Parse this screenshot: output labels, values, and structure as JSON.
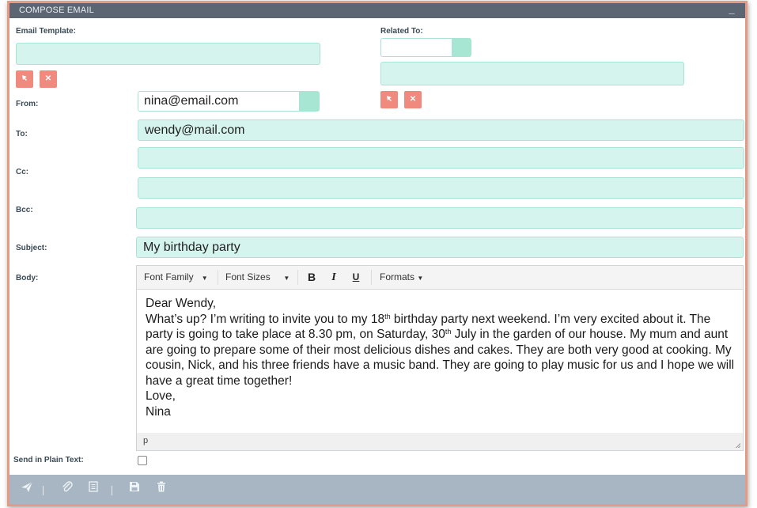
{
  "window": {
    "title": "COMPOSE EMAIL",
    "minimize_label": "_"
  },
  "email_template": {
    "label": "Email Template:",
    "value": ""
  },
  "related_to": {
    "label": "Related To:",
    "select_value": "",
    "value": ""
  },
  "from": {
    "label": "From:",
    "value": "nina@email.com"
  },
  "to": {
    "label": "To:",
    "value": "wendy@mail.com"
  },
  "cc": {
    "label": "Cc:",
    "value": ""
  },
  "bcc": {
    "label": "Bcc:",
    "value": ""
  },
  "subject": {
    "label": "Subject:",
    "value": "My birthday party"
  },
  "body": {
    "label": "Body:",
    "toolbar": {
      "font_family": "Font Family",
      "font_sizes": "Font Sizes",
      "bold": "B",
      "italic": "I",
      "underline": "U",
      "formats": "Formats"
    },
    "greeting": "Dear Wendy,",
    "para_part1": "What’s up? I’m writing to invite you to my 18",
    "sup1": "th",
    "para_part2": " birthday party next weekend. I’m very excited about it. The party is going to take place at 8.30 pm, on Saturday, 30",
    "sup2": "th",
    "para_part3": " July in the garden of our house. My mum and aunt are going to prepare some of their most delicious dishes and cakes. They are both very good at cooking. My cousin, Nick, and his three friends have a music band. They are going to play music for us and I hope we will have a great time together!",
    "closing": "Love,",
    "signature": "Nina",
    "status_path": "p"
  },
  "plain_text": {
    "label": "Send in Plain Text:",
    "checked": false
  },
  "icons": {
    "send": "send-icon",
    "attach": "paperclip-icon",
    "document": "document-icon",
    "save_draft": "save-icon",
    "delete": "trash-icon"
  },
  "colors": {
    "field_bg": "#d6f4ee",
    "select_btn": "#a6e6d3",
    "action_btn": "#f08a7e",
    "title_bar": "#5c6673",
    "bottom_bar": "#a7b6c2",
    "frame_border": "#e79a82"
  }
}
